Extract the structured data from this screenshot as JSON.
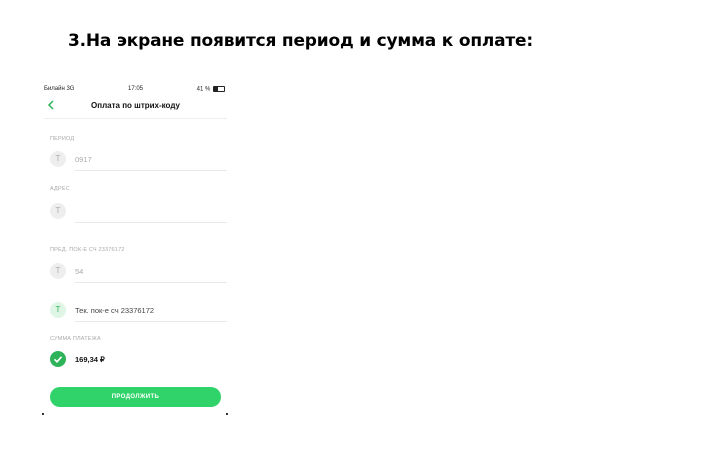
{
  "heading": "3.На экране появится период и сумма к оплате:",
  "statusbar": {
    "carrier": "Билайн  3G",
    "time": "17:05",
    "right": "41 %"
  },
  "nav": {
    "back_icon": "chevron-left-icon",
    "title": "Оплата по штрих-коду"
  },
  "fields": {
    "period": {
      "label": "ПЕРИОД",
      "value": "0917",
      "icon_letter": "T"
    },
    "address": {
      "label": "АДРЕС",
      "value": "",
      "icon_letter": "T"
    },
    "prev_reading": {
      "label": "ПРЕД. ПОК-Е СЧ 23376172",
      "value": "54",
      "icon_letter": "T"
    },
    "current_reading": {
      "placeholder": "Тек. пок-е сч 23376172",
      "icon_letter": "T"
    },
    "amount": {
      "label": "СУММА ПЛАТЕЖА",
      "value": "169,34 ₽",
      "icon": "check-icon"
    }
  },
  "button": {
    "label": "ПРОДОЛЖИТЬ"
  },
  "colors": {
    "accent": "#2fb35a",
    "button": "#2fd36a"
  }
}
